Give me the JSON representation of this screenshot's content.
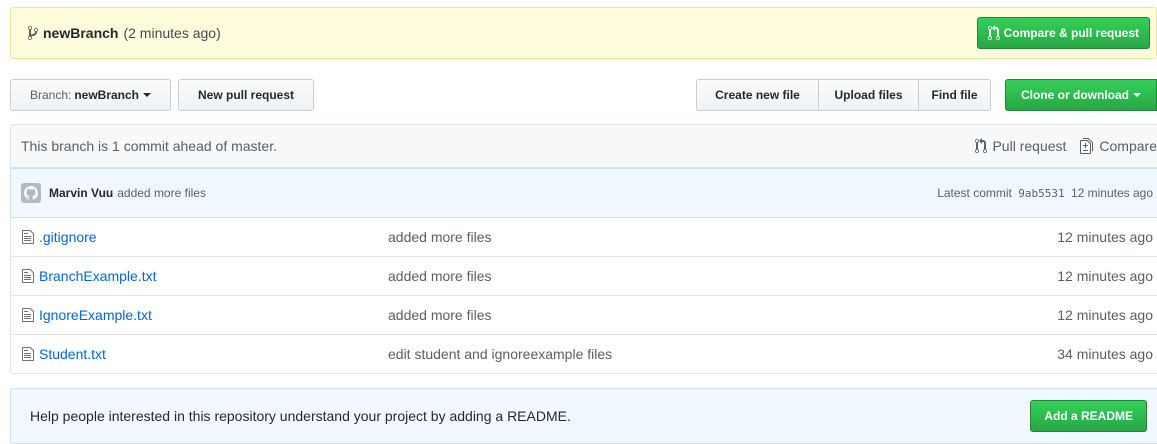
{
  "push_banner": {
    "branch": "newBranch",
    "time": "(2 minutes ago)",
    "compare_button": "Compare & pull request"
  },
  "toolbar": {
    "branch_prefix": "Branch:",
    "branch_name": "newBranch",
    "new_pr": "New pull request",
    "create_file": "Create new file",
    "upload_files": "Upload files",
    "find_file": "Find file",
    "clone": "Clone or download"
  },
  "branch_status": {
    "text": "This branch is 1 commit ahead of master.",
    "pull_request": "Pull request",
    "compare": "Compare"
  },
  "latest_commit": {
    "author": "Marvin Vuu",
    "message": "added more files",
    "label": "Latest commit",
    "sha": "9ab5531",
    "time": "12 minutes ago"
  },
  "files": [
    {
      "name": ".gitignore",
      "message": "added more files",
      "age": "12 minutes ago"
    },
    {
      "name": "BranchExample.txt",
      "message": "added more files",
      "age": "12 minutes ago"
    },
    {
      "name": "IgnoreExample.txt",
      "message": "added more files",
      "age": "12 minutes ago"
    },
    {
      "name": "Student.txt",
      "message": "edit student and ignoreexample files",
      "age": "34 minutes ago"
    }
  ],
  "readme": {
    "text": "Help people interested in this repository understand your project by adding a README.",
    "button": "Add a README"
  },
  "colors": {
    "banner_bg": "#fffbdd",
    "primary_green": "#28a745",
    "link_blue": "#0366d6",
    "info_bg": "#f1f8ff"
  },
  "icons": {
    "branch": "git-branch-icon",
    "pull_request": "git-pull-request-icon",
    "compare": "diff-icon",
    "file": "file-text-icon",
    "avatar": "octocat-avatar"
  }
}
